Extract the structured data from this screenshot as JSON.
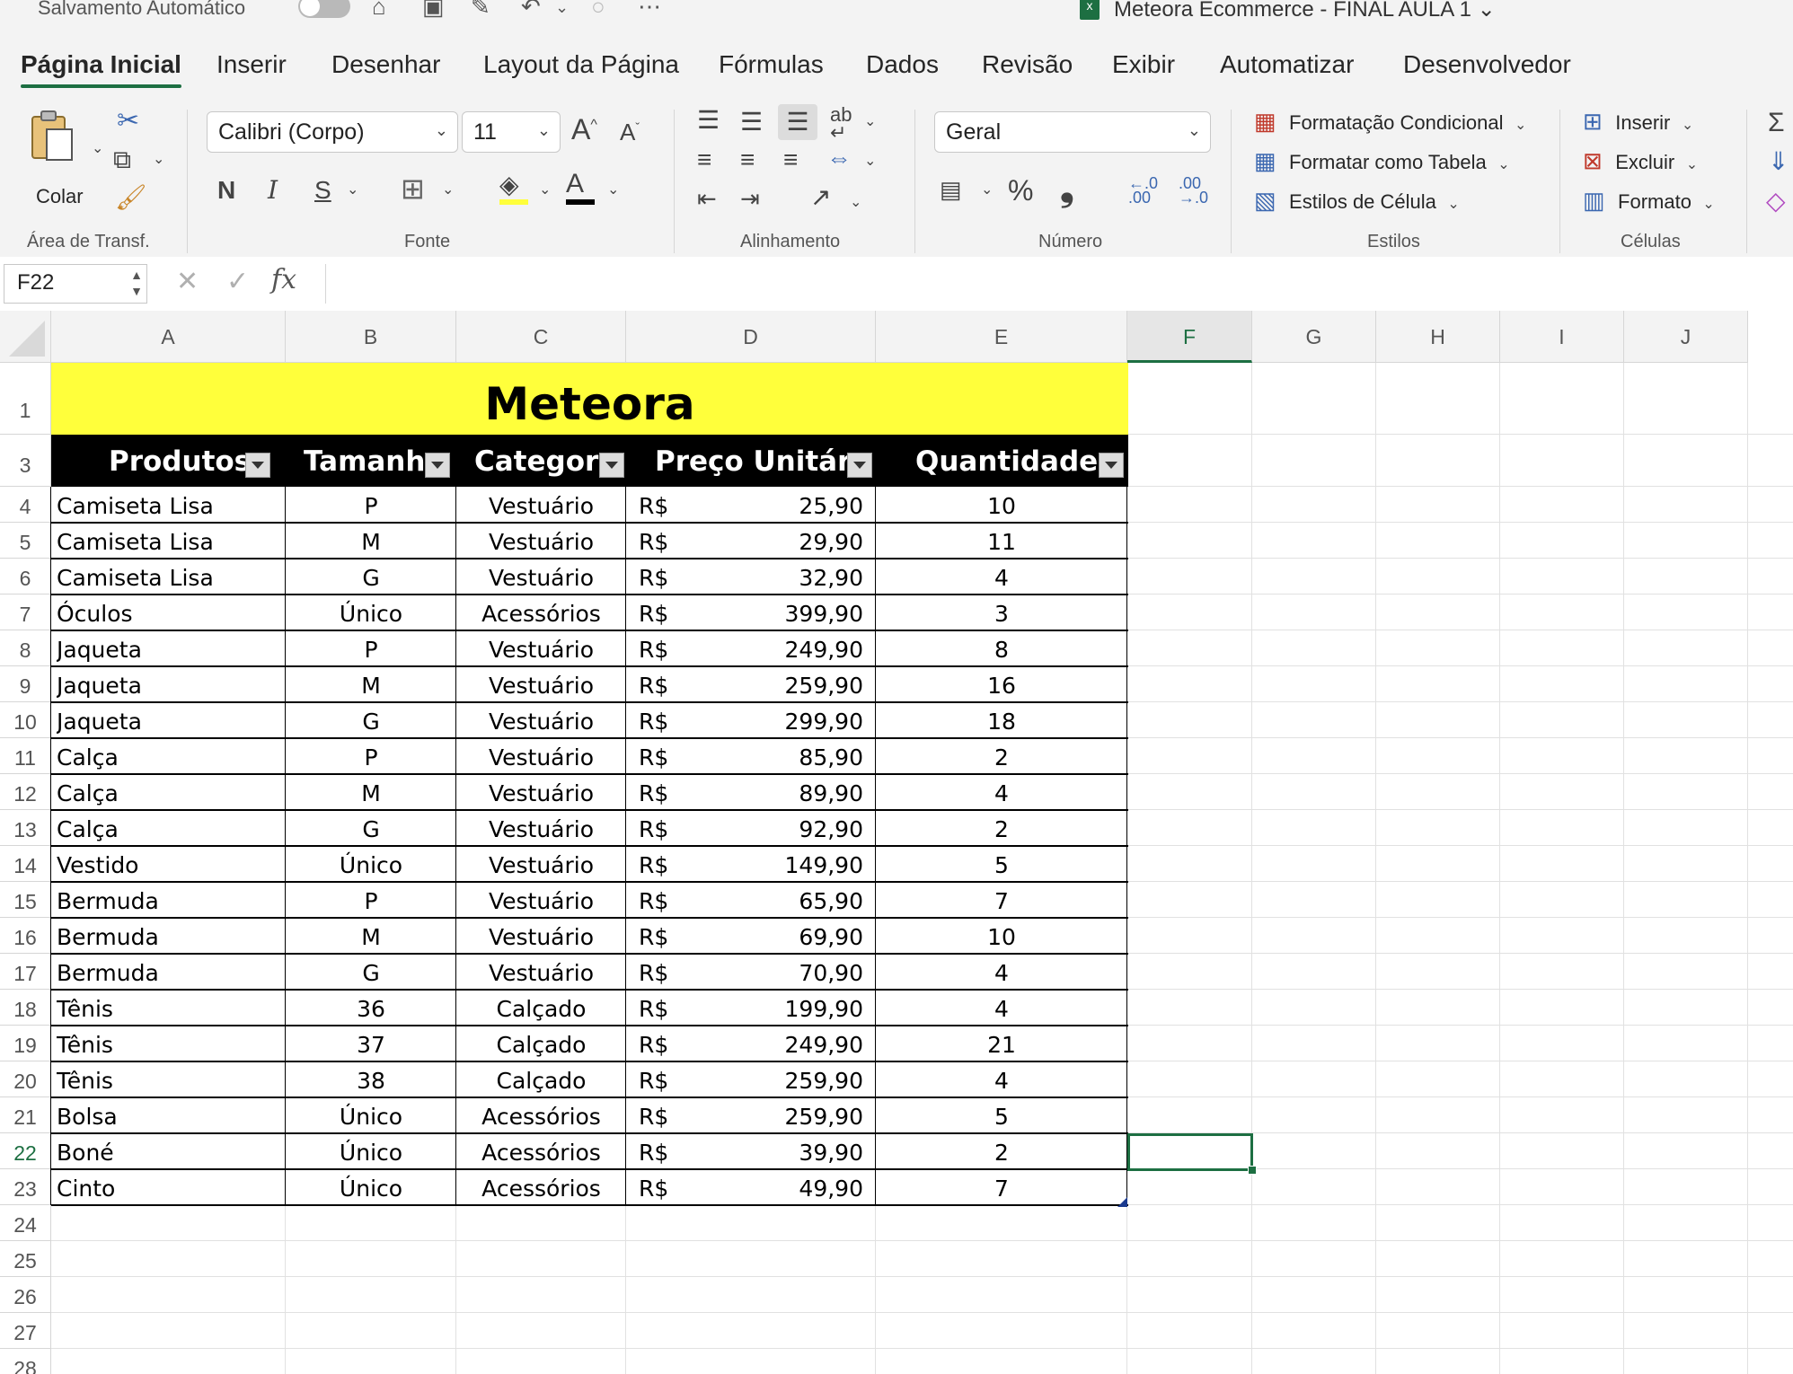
{
  "titlebar": {
    "autosave_label": "Salvamento Automático",
    "document_title": "Meteora Ecommerce - FINAL AULA 1",
    "title_chevron": "⌄"
  },
  "tabs": [
    {
      "label": "Página Inicial",
      "active": true
    },
    {
      "label": "Inserir"
    },
    {
      "label": "Desenhar"
    },
    {
      "label": "Layout da Página"
    },
    {
      "label": "Fórmulas"
    },
    {
      "label": "Dados"
    },
    {
      "label": "Revisão"
    },
    {
      "label": "Exibir"
    },
    {
      "label": "Automatizar"
    },
    {
      "label": "Desenvolvedor"
    }
  ],
  "ribbon": {
    "clipboard": {
      "paste_label": "Colar",
      "group_label": "Área de Transf."
    },
    "font": {
      "font_name": "Calibri (Corpo)",
      "font_size": "11",
      "bold": "N",
      "italic": "I",
      "underline": "S",
      "group_label": "Fonte"
    },
    "alignment": {
      "group_label": "Alinhamento"
    },
    "number": {
      "format": "Geral",
      "percent": "%",
      "comma": "❟",
      "group_label": "Número"
    },
    "styles": {
      "conditional": "Formatação Condicional",
      "as_table": "Formatar como Tabela",
      "cell_styles": "Estilos de Célula",
      "group_label": "Estilos"
    },
    "cells": {
      "insert": "Inserir",
      "delete": "Excluir",
      "format": "Formato",
      "group_label": "Células"
    }
  },
  "formula_bar": {
    "name_box": "F22",
    "fx": "fx",
    "value": ""
  },
  "grid": {
    "columns": [
      "A",
      "B",
      "C",
      "D",
      "E",
      "F",
      "G",
      "H",
      "I",
      "J"
    ],
    "selected_column": "F",
    "rows": [
      "1",
      "3",
      "4",
      "5",
      "6",
      "7",
      "8",
      "9",
      "10",
      "11",
      "12",
      "13",
      "14",
      "15",
      "16",
      "17",
      "18",
      "19",
      "20",
      "21",
      "22",
      "23",
      "24",
      "25",
      "26",
      "27",
      "28"
    ],
    "selected_row": "22",
    "title": "Meteora",
    "headers": [
      "Produtos",
      "Tamanho",
      "Categoria",
      "Preço Unitário",
      "Quantidade"
    ],
    "currency": "R$",
    "data": [
      [
        "Camiseta Lisa",
        "P",
        "Vestuário",
        "25,90",
        "10"
      ],
      [
        "Camiseta Lisa",
        "M",
        "Vestuário",
        "29,90",
        "11"
      ],
      [
        "Camiseta Lisa",
        "G",
        "Vestuário",
        "32,90",
        "4"
      ],
      [
        "Óculos",
        "Único",
        "Acessórios",
        "399,90",
        "3"
      ],
      [
        "Jaqueta",
        "P",
        "Vestuário",
        "249,90",
        "8"
      ],
      [
        "Jaqueta",
        "M",
        "Vestuário",
        "259,90",
        "16"
      ],
      [
        "Jaqueta",
        "G",
        "Vestuário",
        "299,90",
        "18"
      ],
      [
        "Calça",
        "P",
        "Vestuário",
        "85,90",
        "2"
      ],
      [
        "Calça",
        "M",
        "Vestuário",
        "89,90",
        "4"
      ],
      [
        "Calça",
        "G",
        "Vestuário",
        "92,90",
        "2"
      ],
      [
        "Vestido",
        "Único",
        "Vestuário",
        "149,90",
        "5"
      ],
      [
        "Bermuda",
        "P",
        "Vestuário",
        "65,90",
        "7"
      ],
      [
        "Bermuda",
        "M",
        "Vestuário",
        "69,90",
        "10"
      ],
      [
        "Bermuda",
        "G",
        "Vestuário",
        "70,90",
        "4"
      ],
      [
        "Tênis",
        "36",
        "Calçado",
        "199,90",
        "4"
      ],
      [
        "Tênis",
        "37",
        "Calçado",
        "249,90",
        "21"
      ],
      [
        "Tênis",
        "38",
        "Calçado",
        "259,90",
        "4"
      ],
      [
        "Bolsa",
        "Único",
        "Acessórios",
        "259,90",
        "5"
      ],
      [
        "Boné",
        "Único",
        "Acessórios",
        "39,90",
        "2"
      ],
      [
        "Cinto",
        "Único",
        "Acessórios",
        "49,90",
        "7"
      ]
    ]
  }
}
